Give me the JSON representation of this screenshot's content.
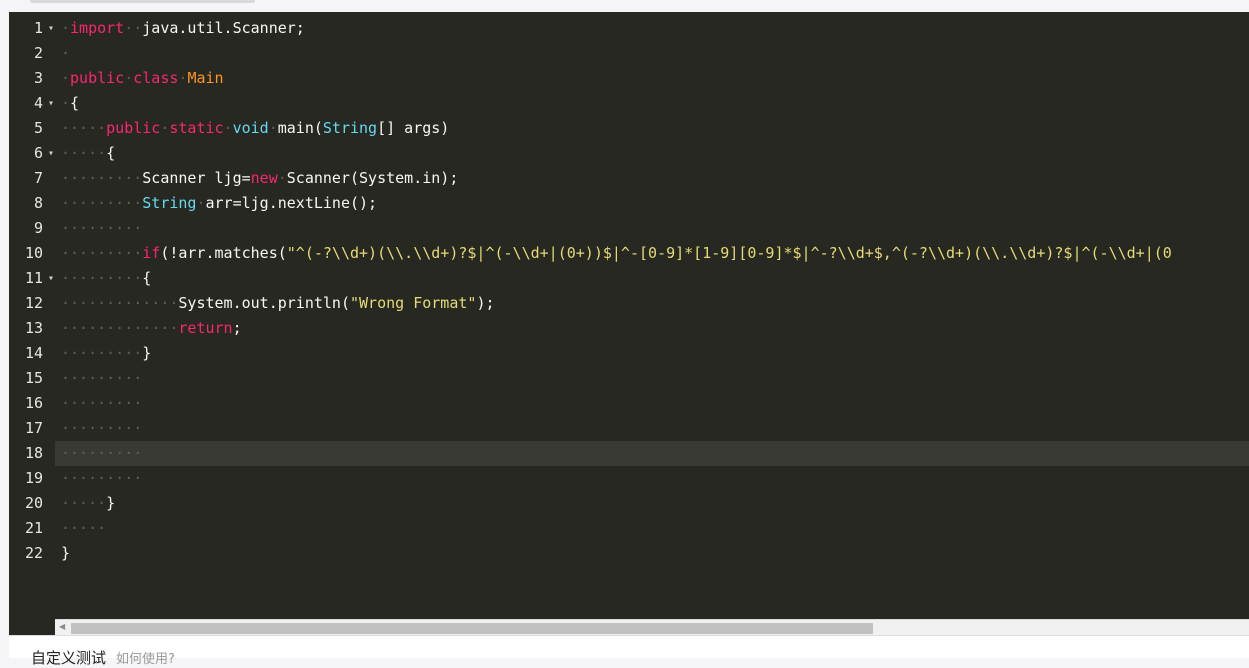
{
  "editor": {
    "line_numbers": [
      "1",
      "2",
      "3",
      "4",
      "5",
      "6",
      "7",
      "8",
      "9",
      "10",
      "11",
      "12",
      "13",
      "14",
      "15",
      "16",
      "17",
      "18",
      "19",
      "20",
      "21",
      "22"
    ],
    "fold_marker": "▾",
    "active_line": 18,
    "code": {
      "l1_kw": "import",
      "l1_rest": "java.util.Scanner;",
      "l3_kw1": "public",
      "l3_kw2": "class",
      "l3_cls": "Main",
      "brace_open": "{",
      "brace_close": "}",
      "l5_kw1": "public",
      "l5_kw2": "static",
      "l5_type": "void",
      "l5_name": "main(",
      "l5_type2": "String",
      "l5_rest": "[] args)",
      "l7_a": "Scanner ljg=",
      "l7_kw": "new",
      "l7_b": "Scanner(System.in);",
      "l8_type": "String",
      "l8_rest": "arr=ljg.nextLine();",
      "l10_kw": "if",
      "l10_a": "(!arr.matches(",
      "l10_str": "\"^(-?\\\\d+)(\\\\.\\\\d+)?$|^(-\\\\d+|(0+))$|^-[0-9]*[1-9][0-9]*$|^-?\\\\d+$,^(-?\\\\d+)(\\\\.\\\\d+)?$|^(-\\\\d+|(0",
      "l12_a": "System.out.println(",
      "l12_str": "\"Wrong Format\"",
      "l12_b": ");",
      "l13_kw": "return",
      "l13_b": ";"
    }
  },
  "bottom": {
    "title": "自定义测试",
    "link": "如何使用?"
  }
}
